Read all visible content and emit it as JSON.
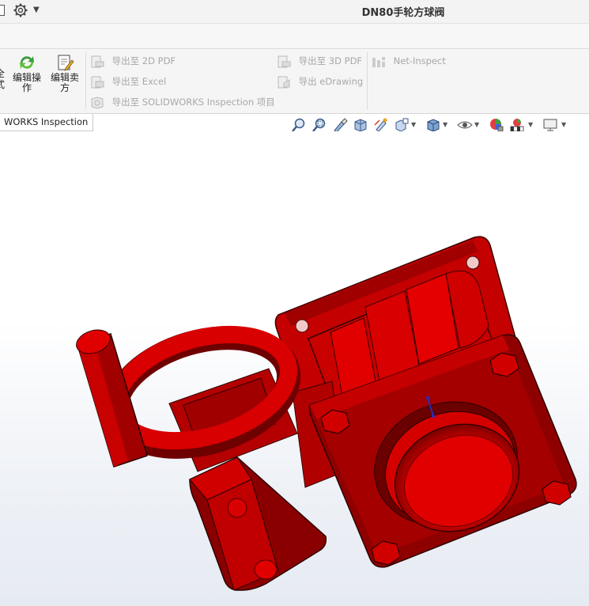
{
  "titlebar": {
    "title": "DN80手轮方球阀",
    "icons": [
      "document-icon",
      "gear-icon",
      "chevron-down-icon"
    ]
  },
  "ribbon": {
    "cut_label": "全式",
    "buttons": [
      {
        "label_line1": "编辑操",
        "label_line2": "作",
        "icon": "edit-operation-icon"
      },
      {
        "label_line1": "编辑卖",
        "label_line2": "方",
        "icon": "edit-vendor-icon"
      }
    ],
    "export_items": {
      "pdf2d": "导出至 2D PDF",
      "excel": "导出至 Excel",
      "sw_inspection": "导出至 SOLIDWORKS Inspection 项目",
      "pdf3d": "导出至 3D PDF",
      "edrawing": "导出 eDrawing",
      "net_inspect": "Net-Inspect"
    }
  },
  "tabs": {
    "active": "WORKS Inspection"
  },
  "view_toolbar": {
    "icons": [
      "zoom-to-fit-icon",
      "zoom-to-area-icon",
      "previous-view-icon",
      "section-view-icon",
      "dynamic-annotation-icon",
      "view-orientation-icon",
      "display-style-icon",
      "hide-show-items-icon",
      "edit-appearance-icon",
      "apply-scene-icon",
      "view-settings-icon"
    ]
  },
  "model": {
    "name": "DN80手轮方球阀",
    "color": "#d40000",
    "shade_color": "#7a0000"
  },
  "colors": {
    "accent_green": "#3a9a3a",
    "disabled_text": "#a8a8a8"
  }
}
